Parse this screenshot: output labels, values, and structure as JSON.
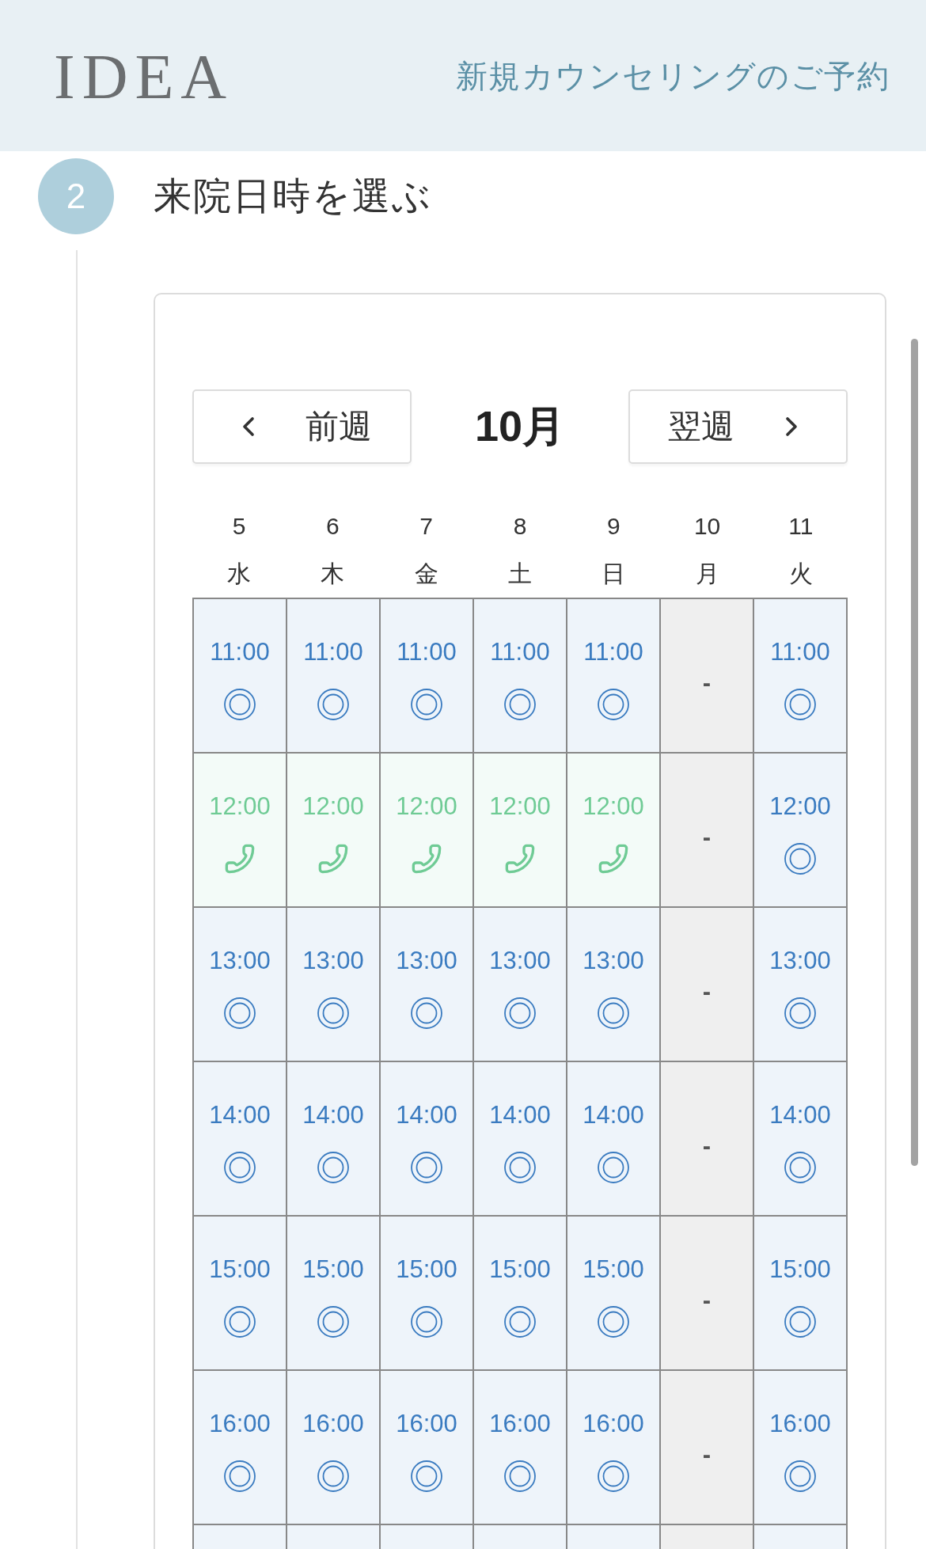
{
  "header": {
    "logo": "IDEA",
    "title": "新規カウンセリングのご予約"
  },
  "step": {
    "number": "2",
    "title": "来院日時を選ぶ"
  },
  "calendar": {
    "prev_button": "前週",
    "month": "10月",
    "next_button": "翌週",
    "days": [
      {
        "date": "5",
        "weekday": "水"
      },
      {
        "date": "6",
        "weekday": "木"
      },
      {
        "date": "7",
        "weekday": "金"
      },
      {
        "date": "8",
        "weekday": "土"
      },
      {
        "date": "9",
        "weekday": "日"
      },
      {
        "date": "10",
        "weekday": "月"
      },
      {
        "date": "11",
        "weekday": "火"
      }
    ],
    "rows": [
      {
        "cells": [
          {
            "kind": "available",
            "time": "11:00"
          },
          {
            "kind": "available",
            "time": "11:00"
          },
          {
            "kind": "available",
            "time": "11:00"
          },
          {
            "kind": "available",
            "time": "11:00"
          },
          {
            "kind": "available",
            "time": "11:00"
          },
          {
            "kind": "closed",
            "mark": "-"
          },
          {
            "kind": "available",
            "time": "11:00"
          }
        ]
      },
      {
        "cells": [
          {
            "kind": "phone",
            "time": "12:00"
          },
          {
            "kind": "phone",
            "time": "12:00"
          },
          {
            "kind": "phone",
            "time": "12:00"
          },
          {
            "kind": "phone",
            "time": "12:00"
          },
          {
            "kind": "phone",
            "time": "12:00"
          },
          {
            "kind": "closed",
            "mark": "-"
          },
          {
            "kind": "available",
            "time": "12:00"
          }
        ]
      },
      {
        "cells": [
          {
            "kind": "available",
            "time": "13:00"
          },
          {
            "kind": "available",
            "time": "13:00"
          },
          {
            "kind": "available",
            "time": "13:00"
          },
          {
            "kind": "available",
            "time": "13:00"
          },
          {
            "kind": "available",
            "time": "13:00"
          },
          {
            "kind": "closed",
            "mark": "-"
          },
          {
            "kind": "available",
            "time": "13:00"
          }
        ]
      },
      {
        "cells": [
          {
            "kind": "available",
            "time": "14:00"
          },
          {
            "kind": "available",
            "time": "14:00"
          },
          {
            "kind": "available",
            "time": "14:00"
          },
          {
            "kind": "available",
            "time": "14:00"
          },
          {
            "kind": "available",
            "time": "14:00"
          },
          {
            "kind": "closed",
            "mark": "-"
          },
          {
            "kind": "available",
            "time": "14:00"
          }
        ]
      },
      {
        "cells": [
          {
            "kind": "available",
            "time": "15:00"
          },
          {
            "kind": "available",
            "time": "15:00"
          },
          {
            "kind": "available",
            "time": "15:00"
          },
          {
            "kind": "available",
            "time": "15:00"
          },
          {
            "kind": "available",
            "time": "15:00"
          },
          {
            "kind": "closed",
            "mark": "-"
          },
          {
            "kind": "available",
            "time": "15:00"
          }
        ]
      },
      {
        "cells": [
          {
            "kind": "available",
            "time": "16:00"
          },
          {
            "kind": "available",
            "time": "16:00"
          },
          {
            "kind": "available",
            "time": "16:00"
          },
          {
            "kind": "available",
            "time": "16:00"
          },
          {
            "kind": "available",
            "time": "16:00"
          },
          {
            "kind": "closed",
            "mark": "-"
          },
          {
            "kind": "available",
            "time": "16:00"
          }
        ]
      },
      {
        "cells": [
          {
            "kind": "available"
          },
          {
            "kind": "available"
          },
          {
            "kind": "available"
          },
          {
            "kind": "available"
          },
          {
            "kind": "available"
          },
          {
            "kind": "closed"
          },
          {
            "kind": "available"
          }
        ]
      }
    ]
  }
}
